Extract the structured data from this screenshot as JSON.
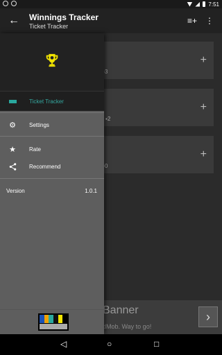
{
  "status_bar": {
    "time": "7:51"
  },
  "app_bar": {
    "title": "Winnings Tracker",
    "subtitle": "Ticket Tracker",
    "back_icon": "arrow-left-icon",
    "add_list_icon": "playlist-add-icon",
    "more_icon": "more-vert-icon"
  },
  "cards": [
    {
      "count": "3",
      "add_icon": "plus-icon"
    },
    {
      "count": "2",
      "add_icon": "plus-icon"
    },
    {
      "count": "0",
      "add_icon": "plus-icon"
    }
  ],
  "banner": {
    "title": "Banner",
    "subtitle": "dMob. Way to go!",
    "arrow": "›"
  },
  "drawer": {
    "header_icon": "trophy-icon",
    "items": [
      {
        "label": "Ticket Tracker",
        "icon": "ticket-icon",
        "selected": true
      },
      {
        "label": "Settings",
        "icon": "gear-icon"
      },
      {
        "label": "Rate",
        "icon": "star-icon"
      },
      {
        "label": "Recommend",
        "icon": "share-icon"
      }
    ],
    "version_label": "Version",
    "version_value": "1.0.1"
  },
  "colors": {
    "accent": "#2aa89e",
    "trophy": "#f2e400",
    "drawer_bg": "#5e5e5e",
    "app_bar": "#222222"
  }
}
